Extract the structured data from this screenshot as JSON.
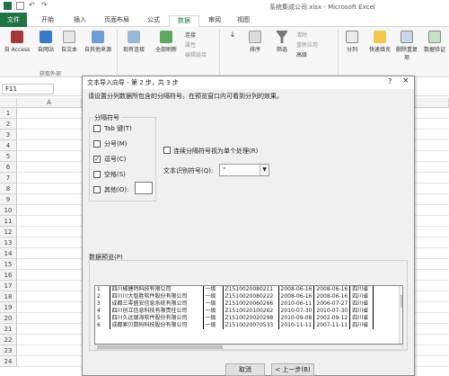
{
  "title": "系统集成公司.xlsx - Microsoft Excel",
  "tabs": [
    "文件",
    "开始",
    "插入",
    "页面布局",
    "公式",
    "数据",
    "审阅",
    "视图"
  ],
  "ribbon": {
    "access": "自 Access",
    "website": "自网站",
    "text": "自文本",
    "other_sources": "自其他来源",
    "existing": "现有连接",
    "refresh_all": "全部刷新",
    "connections": "连接",
    "properties": "属性",
    "edit_links": "编辑链接",
    "sort": "排序",
    "filter": "筛选",
    "clear": "清除",
    "reapply": "重新应用",
    "advanced": "高级",
    "split": "分列",
    "flash_fill": "快速填充",
    "remove_dup": "删除重复项",
    "data_valid": "数据验证",
    "group_label": "获取外部"
  },
  "namebox": "F11",
  "grid": {
    "columns": [
      "A"
    ],
    "rows": [
      "1",
      "2",
      "3",
      "4",
      "5",
      "6",
      "7",
      "8",
      "9",
      "10",
      "11",
      "12",
      "13",
      "14",
      "15",
      "16",
      "17",
      "18",
      "19",
      "20",
      "21",
      "22",
      "23",
      "24"
    ]
  },
  "dialog": {
    "title": "文本导入向导 - 第 2 步，共 3 步",
    "help": "?",
    "close": "×",
    "instruction": "请设置分列数据所包含的分隔符号。在预览窗口内可看到分列的效果。",
    "delimiters_title": "分隔符号",
    "delimiters": [
      {
        "label": "Tab 键(T)",
        "checked": false
      },
      {
        "label": "分号(M)",
        "checked": false
      },
      {
        "label": "逗号(C)",
        "checked": true
      },
      {
        "label": "空格(S)",
        "checked": false
      },
      {
        "label": "其他(O):",
        "checked": false
      }
    ],
    "consecutive_label": "连续分隔符号视为单个处理(R)",
    "qualifier_label": "文本识别符号(Q):",
    "qualifier_value": "\"",
    "preview_label": "数据预览(P)",
    "preview_rows": [
      [
        "1",
        "四川椒搪特科技有限公司",
        "一级",
        "Z1510020080211",
        "2008-06-16",
        "2008-06-16",
        "四川省"
      ],
      [
        "2",
        "四川川大智胜软件股份有限公司",
        "一级",
        "Z1510020080222",
        "2008-06-16",
        "2008-06-16",
        "四川省"
      ],
      [
        "3",
        "成都三零盛安信息系统有限公司",
        "一级",
        "Z1510020060266",
        "2010-06-11",
        "2006-07-27",
        "四川省"
      ],
      [
        "4",
        "四川创立信息科技有限责任公司",
        "一级",
        "Z1510020100262",
        "2010-07-30",
        "2010-07-30",
        "四川省"
      ],
      [
        "5",
        "四川久远银海软件股份有限公司",
        "一级",
        "Z1510020020298",
        "2010-09-08",
        "2002-09-12",
        "四川省"
      ],
      [
        "6",
        "成都索贝数码科技股份有限公司",
        "一级",
        "Z1510020070533",
        "2010-11-11",
        "2007-11-11",
        "四川省"
      ]
    ],
    "buttons": {
      "cancel": "取消",
      "back": "< 上一步(B)"
    }
  },
  "colors": {
    "excel_green": "#217346",
    "dialog_bg": "#f0f0f0"
  }
}
